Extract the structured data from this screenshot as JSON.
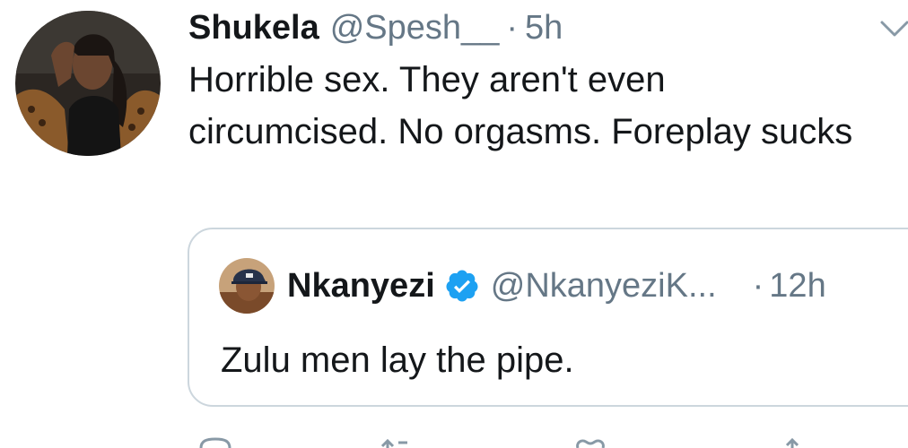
{
  "tweet": {
    "author_name": "Shukela",
    "author_handle": "@Spesh__",
    "separator": "·",
    "time": "5h",
    "text": "Horrible sex. They aren't even circumcised. No orgasms. Foreplay sucks",
    "avatar_icon": "user-avatar-photo",
    "menu_icon": "chevron-down-icon"
  },
  "quoted": {
    "author_name": "Nkanyezi",
    "verified_icon": "verified-badge-icon",
    "author_handle": "@NkanyeziK...",
    "separator": "·",
    "time": "12h",
    "text": "Zulu men lay the pipe.",
    "avatar_icon": "user-avatar-photo"
  },
  "actions": {
    "reply_icon": "reply-icon",
    "retweet_icon": "retweet-icon",
    "like_icon": "heart-icon",
    "share_icon": "share-icon"
  },
  "colors": {
    "text": "#14171a",
    "secondary": "#657786",
    "border": "#ccd6dd",
    "verified": "#1da1f2"
  }
}
